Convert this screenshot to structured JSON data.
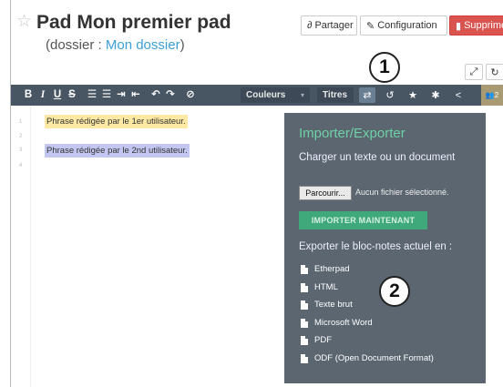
{
  "header": {
    "title": "Pad Mon premier pad",
    "folder_prefix": "(dossier : ",
    "folder_link": "Mon dossier",
    "folder_suffix": ")",
    "buttons": {
      "share": "Partager",
      "config": "Configuration",
      "delete": "Supprimer"
    }
  },
  "callouts": {
    "one": "1",
    "two": "2"
  },
  "toolbar": {
    "bold": "B",
    "italic": "I",
    "underline": "U",
    "strike": "S",
    "colors_label": "Couleurs",
    "titles_label": "Titres",
    "users_count": "2"
  },
  "editor": {
    "line_numbers": [
      "1",
      "2",
      "3",
      "4"
    ],
    "lines": [
      "Phrase rédigée par le 1er utilisateur.",
      "Phrase rédigée par le 2nd utilisateur."
    ]
  },
  "import_export": {
    "title": "Importer/Exporter",
    "subtitle": "Charger un texte ou un document",
    "file_button": "Parcourir...",
    "no_file": "Aucun fichier sélectionné.",
    "import_button": "IMPORTER MAINTENANT",
    "export_label": "Exporter le bloc-notes actuel en :",
    "formats": [
      "Etherpad",
      "HTML",
      "Texte brut",
      "Microsoft Word",
      "PDF",
      "ODF (Open Document Format)"
    ]
  },
  "colors": {
    "toolbar": "#485563",
    "popup": "#5b6670",
    "accent": "#6ed0a6",
    "delete": "#d9534f",
    "link": "#3a9fd6"
  }
}
